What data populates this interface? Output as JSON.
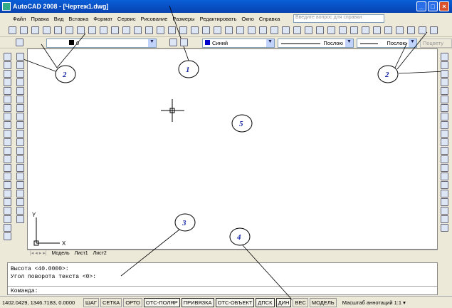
{
  "window": {
    "title": "AutoCAD 2008 - [Чертеж1.dwg]",
    "min": "_",
    "max": "□",
    "close": "×"
  },
  "menu": [
    "Файл",
    "Правка",
    "Вид",
    "Вставка",
    "Формат",
    "Сервис",
    "Рисование",
    "Размеры",
    "Редактировать",
    "Окно",
    "Справка"
  ],
  "help_placeholder": "Введите вопрос для справки",
  "layers": {
    "current_layer": "0",
    "color": "Синий",
    "linetype": "Послою",
    "lineweight": "Послою",
    "plotstyle": "Поцвету"
  },
  "colors": {
    "layer_color": "#0000cc",
    "title_bar": "#0a5fd8"
  },
  "tabs": [
    "Модель",
    "Лист1",
    "Лист2"
  ],
  "ucs": {
    "x": "X",
    "y": "Y"
  },
  "command": {
    "history": [
      "Высота <40.0000>:",
      "Угол поворота текста <0>:"
    ],
    "prompt": "Команда:"
  },
  "status": {
    "coords": "1402.0429, 1346.7183, 0.0000",
    "buttons": [
      "ШАГ",
      "СЕТКА",
      "ОРТО",
      "ОТС-ПОЛЯР",
      "ПРИВЯЗКА",
      "ОТС-ОБЪЕКТ",
      "ДПСК",
      "ДИН",
      "ВЕС",
      "МОДЕЛЬ"
    ],
    "anno_label": "Масштаб аннотаций",
    "anno_scale": "1:1 ▾"
  },
  "callouts": [
    "1",
    "2",
    "2",
    "3",
    "4",
    "5"
  ]
}
